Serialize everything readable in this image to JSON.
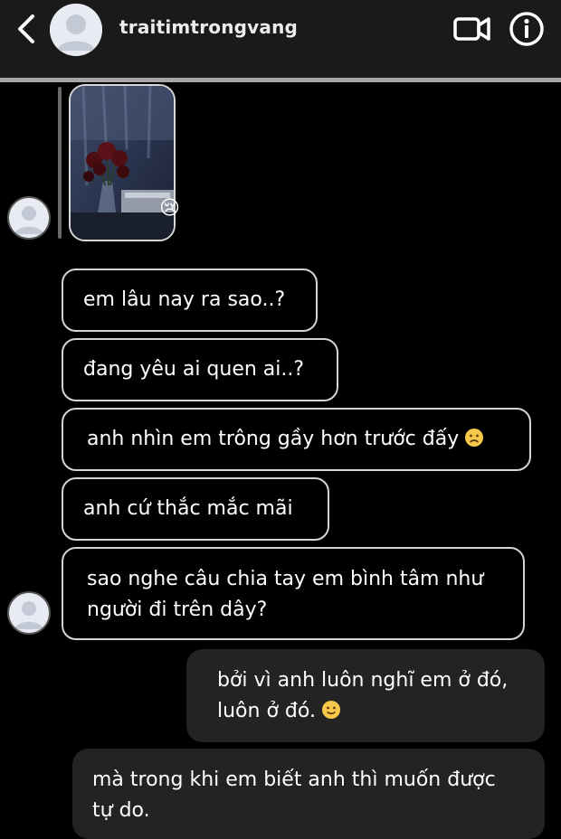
{
  "header": {
    "username": "traitimtrongvang"
  },
  "photo_message": {
    "reaction_emoji": "😢"
  },
  "messages": [
    {
      "text": "em lâu nay ra sao..?"
    },
    {
      "text": "đang yêu ai quen ai..?"
    },
    {
      "text": "anh nhìn em trông gầy hơn trước đấy",
      "emoji": "worried-face"
    },
    {
      "text": "anh cứ thắc mắc mãi"
    },
    {
      "text": "sao nghe câu chia tay em bình tâm như\nngười đi trên dây?"
    }
  ],
  "replies": [
    {
      "text": "bởi vì anh luôn nghĩ em ở đó,\nluôn ở đó.",
      "emoji": "slightly-smiling-face"
    },
    {
      "text": "mà trong khi em biết anh thì muốn được\ntự do."
    }
  ],
  "colors": {
    "header_bg": "#1a1a1a",
    "bubble_out_bg": "#232323",
    "bubble_border": "#d5d5d5"
  }
}
